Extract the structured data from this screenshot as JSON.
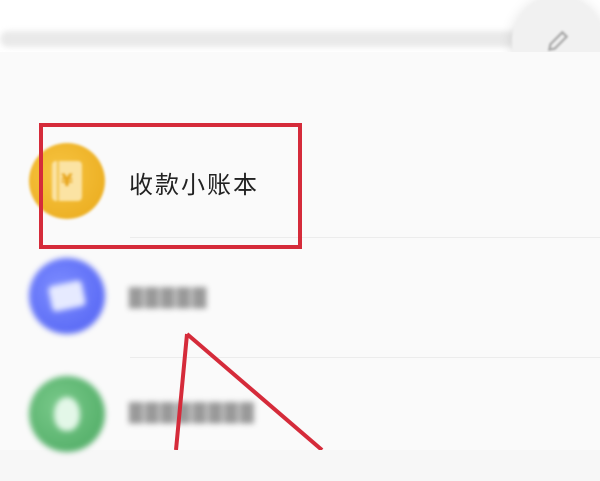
{
  "app_name": "收款小账本",
  "colors": {
    "annotation_red": "#d52b3a",
    "ledger_icon": "#f0b72f",
    "docs_icon": "#5a67f5",
    "tool_icon": "#56b66c"
  },
  "list": {
    "items": [
      {
        "label": "收款小账本",
        "icon": "ledger-yen-icon",
        "highlighted": true
      },
      {
        "icon": "docs-icon"
      },
      {
        "icon": "tool-icon"
      }
    ]
  },
  "edit_icon": "pencil-icon"
}
